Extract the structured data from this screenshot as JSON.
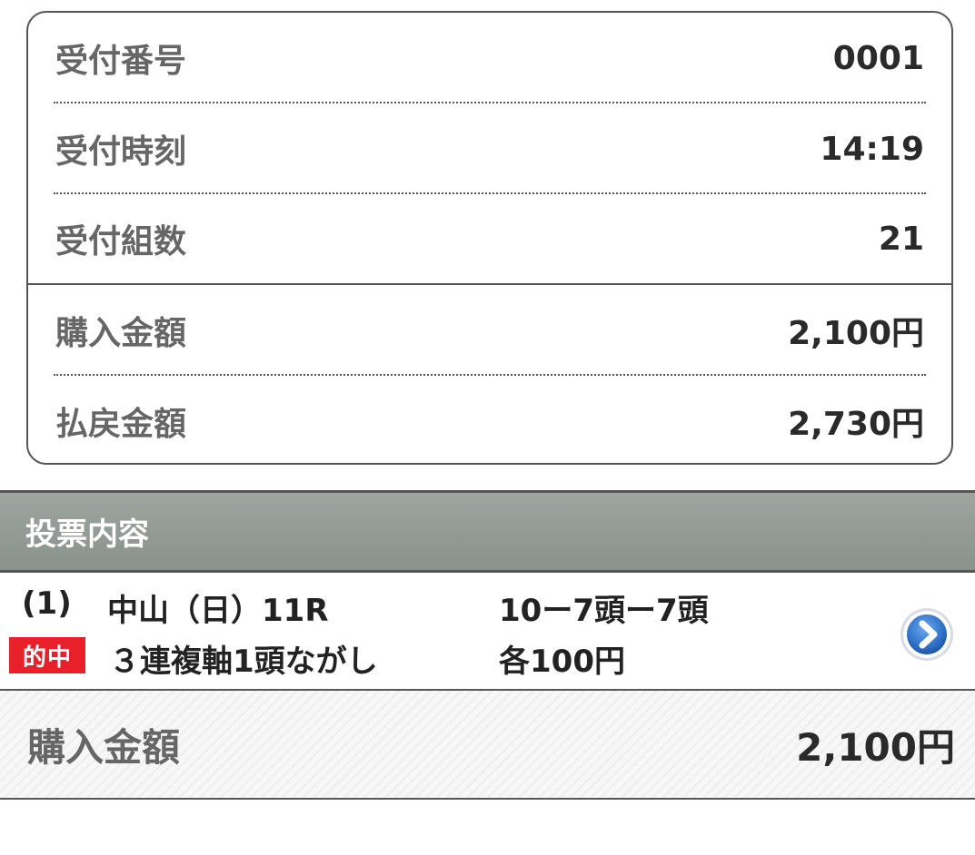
{
  "receipt": {
    "rows": [
      {
        "label": "受付番号",
        "value": "0001"
      },
      {
        "label": "受付時刻",
        "value": "14:19"
      },
      {
        "label": "受付組数",
        "value": "21"
      },
      {
        "label": "購入金額",
        "value": "2,100円"
      },
      {
        "label": "払戻金額",
        "value": "2,730円"
      }
    ]
  },
  "section": {
    "title": "投票内容"
  },
  "bet": {
    "number": "(1)",
    "race": "中山（日）11R",
    "combination": "10ー7頭ー7頭",
    "hit_badge": "的中",
    "bet_type": "３連複軸1頭ながし",
    "amount_each": "各100円",
    "arrow_icon": "chevron-right-circle-icon"
  },
  "total": {
    "label": "購入金額",
    "value": "2,100円"
  },
  "colors": {
    "hit_badge": "#e8202a",
    "header_bg": "#949b96",
    "arrow_btn": "#2f72c9"
  }
}
